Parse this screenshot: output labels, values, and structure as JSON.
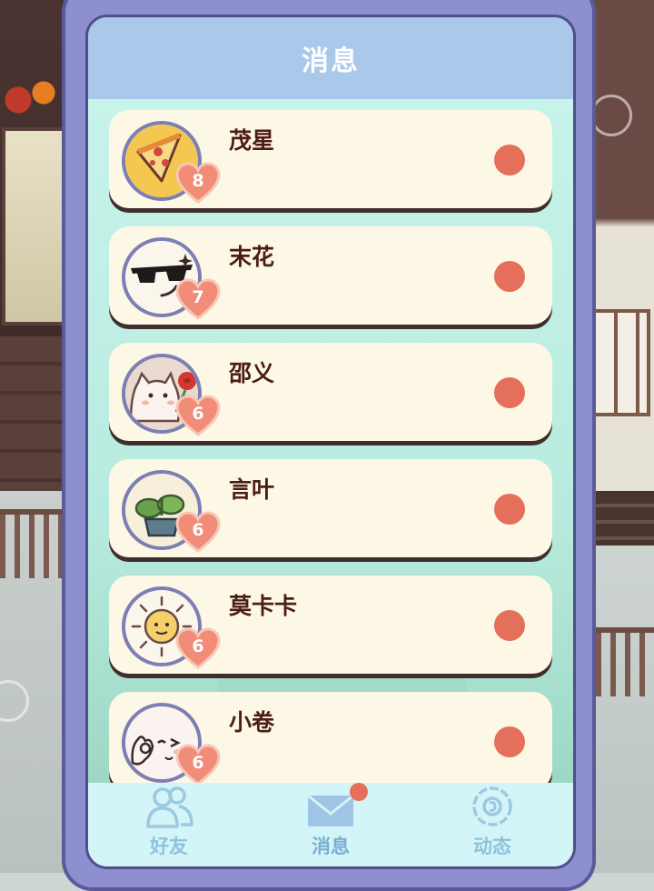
{
  "header": {
    "title": "消息"
  },
  "contacts": [
    {
      "name": "茂星",
      "affinity": "8",
      "avatar_icon": "pizza-icon",
      "unread": true
    },
    {
      "name": "末花",
      "affinity": "7",
      "avatar_icon": "sunglasses-face-icon",
      "unread": true
    },
    {
      "name": "邵义",
      "affinity": "6",
      "avatar_icon": "cat-rose-icon",
      "unread": true
    },
    {
      "name": "言叶",
      "affinity": "6",
      "avatar_icon": "potted-plant-icon",
      "unread": true
    },
    {
      "name": "莫卡卡",
      "affinity": "6",
      "avatar_icon": "sun-face-icon",
      "unread": true
    },
    {
      "name": "小卷",
      "affinity": "6",
      "avatar_icon": "ok-hand-face-icon",
      "unread": true
    }
  ],
  "tabs": [
    {
      "label": "好友",
      "icon": "friends-icon",
      "active": false
    },
    {
      "label": "消息",
      "icon": "envelope-icon",
      "active": true,
      "badge": true
    },
    {
      "label": "动态",
      "icon": "flower-icon",
      "active": false
    }
  ],
  "colors": {
    "header_bg": "#a9c8ea",
    "card_bg": "#fdf7e5",
    "name_text": "#4b1d16",
    "unread_dot": "#e46f5a",
    "heart": "#f08c78",
    "frame": "#8d8fcf"
  }
}
